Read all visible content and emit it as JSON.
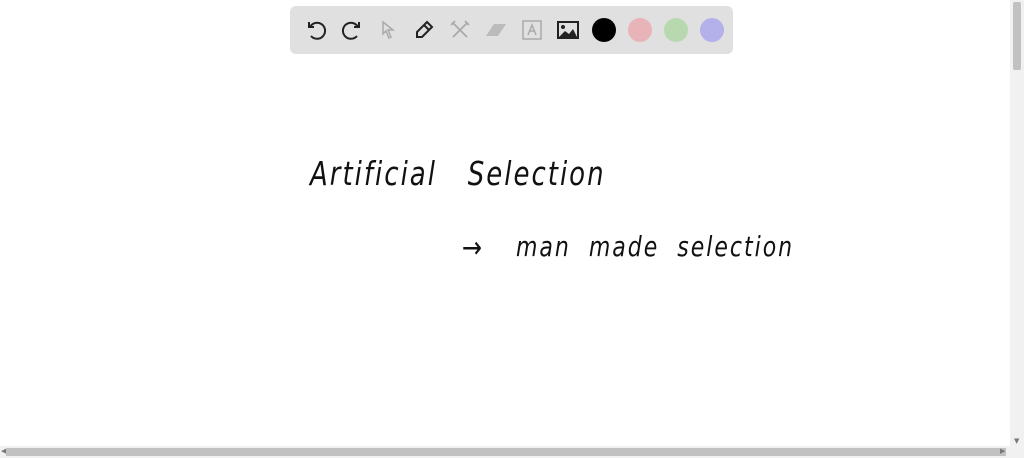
{
  "toolbar": {
    "tools": [
      "undo-icon",
      "redo-icon",
      "select-icon",
      "pen-icon",
      "tools-icon",
      "eraser-icon",
      "text-icon",
      "image-icon"
    ],
    "colors": [
      "#000000",
      "#e8b4b8",
      "#b8d8b0",
      "#b4b0ea"
    ]
  },
  "canvas": {
    "line1": "Artificial   Selection",
    "arrow": "→",
    "line2": "man  made  selection"
  }
}
